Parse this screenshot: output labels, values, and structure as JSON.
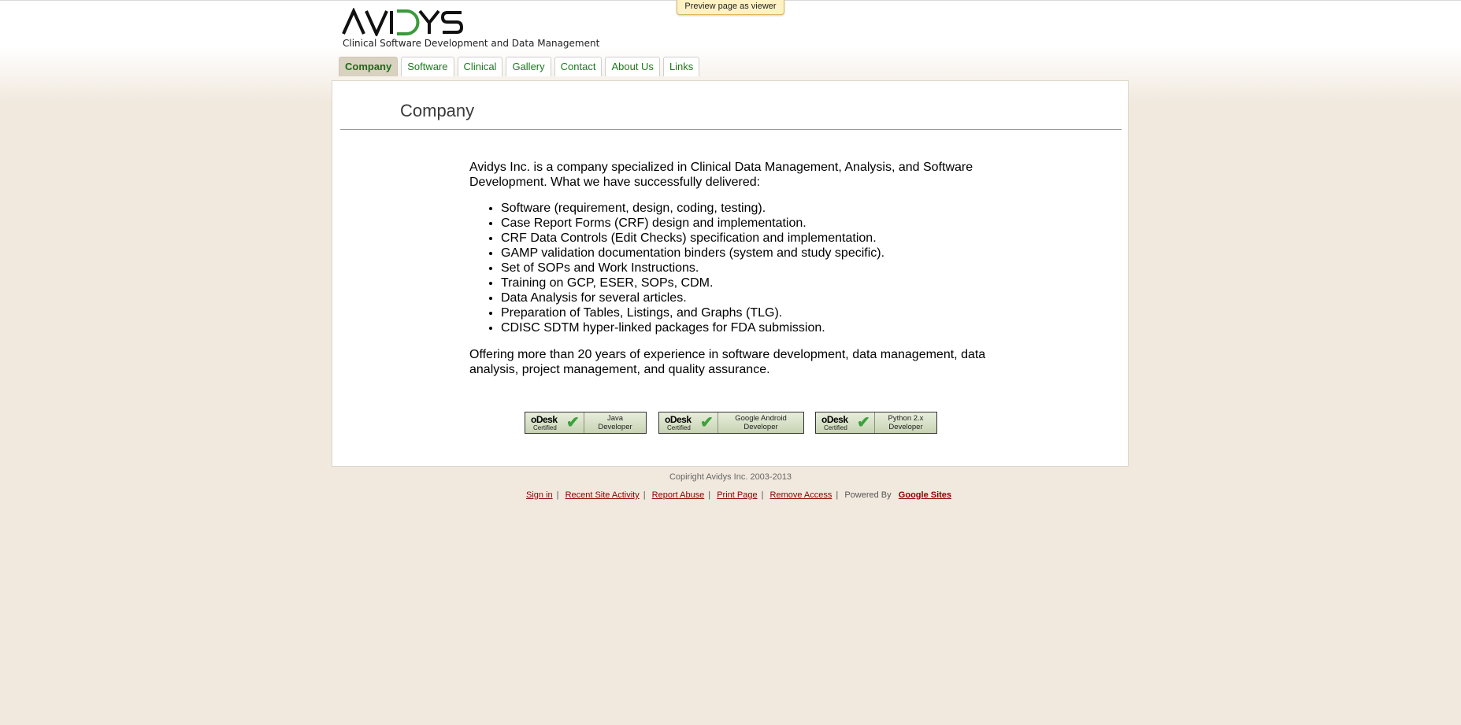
{
  "preview": {
    "label": "Preview page as viewer"
  },
  "header": {
    "logo_text": "AVIDYS",
    "tagline": "Clinical Software Development and Data Management"
  },
  "nav": {
    "tabs": [
      {
        "label": "Company",
        "active": true
      },
      {
        "label": "Software"
      },
      {
        "label": "Clinical"
      },
      {
        "label": "Gallery"
      },
      {
        "label": "Contact"
      },
      {
        "label": "About Us"
      },
      {
        "label": "Links"
      }
    ]
  },
  "main": {
    "title": "Company",
    "intro": "Avidys Inc. is a company specialized in Clinical Data Management, Analysis, and Software Development. What we have successfully delivered:",
    "items": [
      "Software (requirement, design, coding, testing).",
      "Case Report Forms (CRF) design and implementation.",
      "CRF Data Controls (Edit Checks) specification and implementation.",
      "GAMP validation documentation binders (system and study specific).",
      "Set of SOPs and Work Instructions.",
      "Training on GCP, ESER, SOPs, CDM.",
      "Data Analysis for several articles.",
      "Preparation of Tables, Listings, and Graphs (TLG).",
      "CDISC SDTM hyper-linked packages for FDA submission."
    ],
    "outro": "Offering more than 20 years of experience in software development, data management, data analysis, project management, and quality assurance."
  },
  "badges": {
    "brand": "oDesk",
    "certified": "Certified",
    "items": [
      {
        "line1": "Java",
        "line2": "Developer"
      },
      {
        "line1": "Google Android",
        "line2": "Developer"
      },
      {
        "line1": "Python 2.x",
        "line2": "Developer"
      }
    ]
  },
  "footer": {
    "copyright": "Copiright Avidys Inc. 2003-2013",
    "sign_in": "Sign in",
    "recent_activity": "Recent Site Activity",
    "report_abuse": "Report Abuse",
    "print_page": "Print Page",
    "remove_access": "Remove Access",
    "powered_by": "Powered By",
    "google_sites": "Google Sites"
  },
  "colors": {
    "accent_green": "#1a7a1a",
    "link_red": "#8b0000",
    "background": "#f1e9de"
  }
}
